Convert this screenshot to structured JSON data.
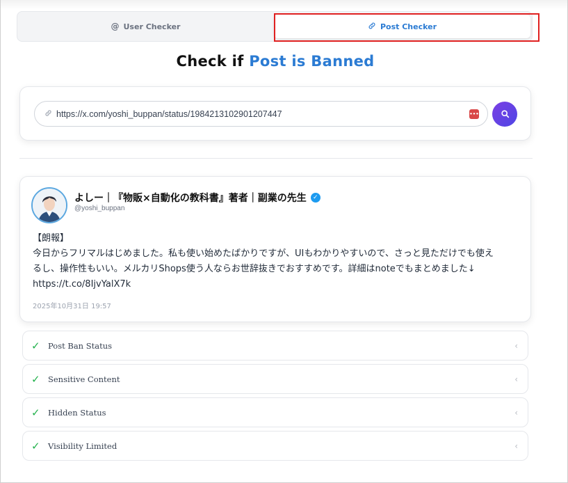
{
  "tabs": [
    {
      "label": "User Checker",
      "icon": "at-icon",
      "active": false
    },
    {
      "label": "Post Checker",
      "icon": "link-icon",
      "active": true
    }
  ],
  "heading": {
    "prefix": "Check if",
    "accent": "Post is Banned"
  },
  "search": {
    "value": "https://x.com/yoshi_buppan/status/1984213102901207447",
    "placeholder": "",
    "password_icon_text": "•••"
  },
  "post": {
    "display_name": "よしー｜『物販×自動化の教科書』著者｜副業の先生",
    "handle": "@yoshi_buppan",
    "verified": true,
    "body_lines": [
      "【朗報】",
      "今日からフリマルはじめました。私も使い始めたばかりですが、UIもわかりやすいので、さっと見ただけでも使え",
      "るし、操作性もいい。メルカリShops使う人ならお世辞抜きでおすすめです。詳細はnoteでもまとめました↓",
      "https://t.co/8IjvYalX7k"
    ],
    "date": "2025年10月31日 19:57"
  },
  "status_items": [
    {
      "label": "Post Ban Status"
    },
    {
      "label": "Sensitive Content"
    },
    {
      "label": "Hidden Status"
    },
    {
      "label": "Visibility Limited"
    }
  ],
  "colors": {
    "accent": "#2b7bd3",
    "highlight": "#e02020",
    "check": "#22b14c"
  }
}
